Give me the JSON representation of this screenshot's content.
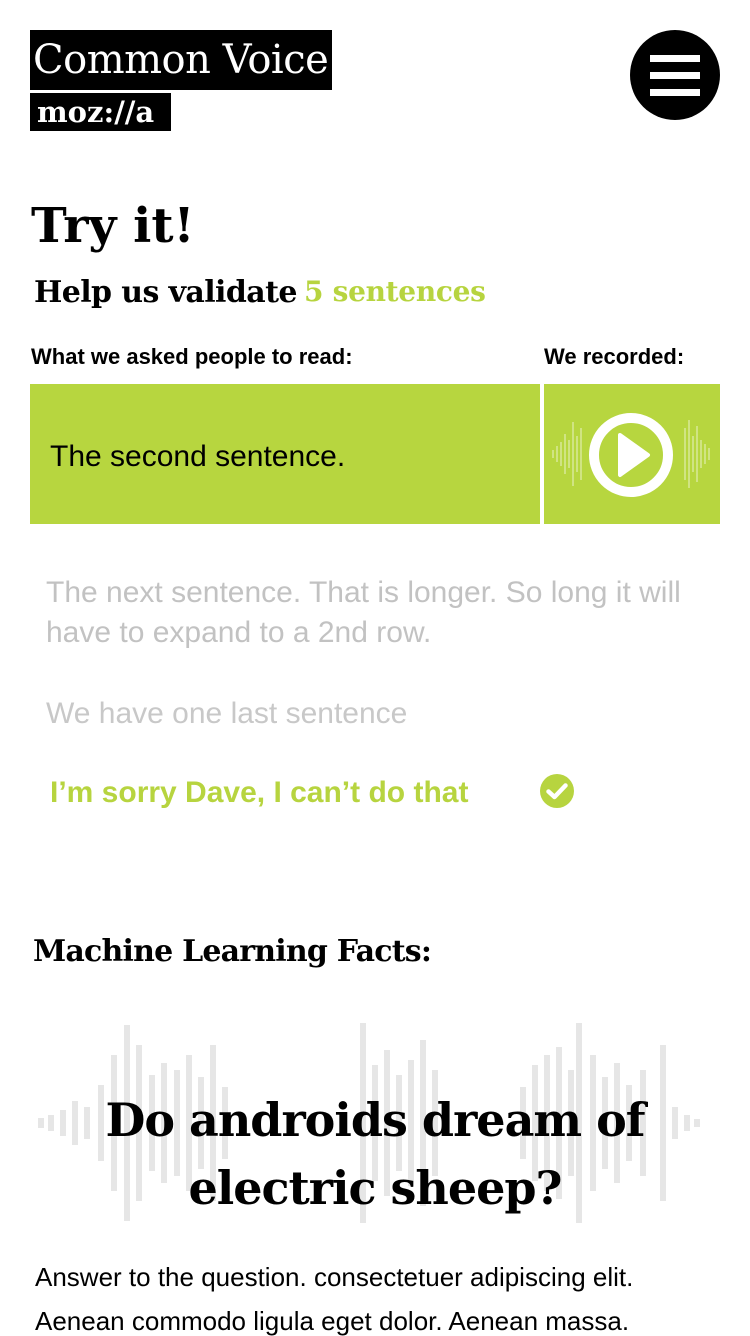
{
  "header": {
    "logo_text": "Common Voice",
    "brand_text": "moz://a",
    "menu_icon": "hamburger-menu-icon"
  },
  "main": {
    "title": "Try it!",
    "help_text": "Help us validate",
    "help_count": "5 sentences",
    "label_read": "What we asked people to read:",
    "label_recorded": "We recorded:",
    "current_sentence": "The second sentence.",
    "play_icon": "play-icon",
    "next_sentences": [
      "The next sentence. That is longer. So long it will have to expand to a 2nd row.",
      "We have one last sentence"
    ],
    "validated_sentence": "I’m sorry Dave, I can’t do that",
    "validated_icon": "check-circle-icon"
  },
  "facts": {
    "title": "Machine Learning Facts:",
    "question": "Do androids dream of electric sheep?",
    "answer": "Answer to the question. consectetuer adipiscing elit. Aenean commodo ligula eget dolor. Aenean massa."
  },
  "colors": {
    "accent": "#b7d63f",
    "text": "#000000",
    "muted": "#c2c2c2",
    "background": "#ffffff"
  }
}
